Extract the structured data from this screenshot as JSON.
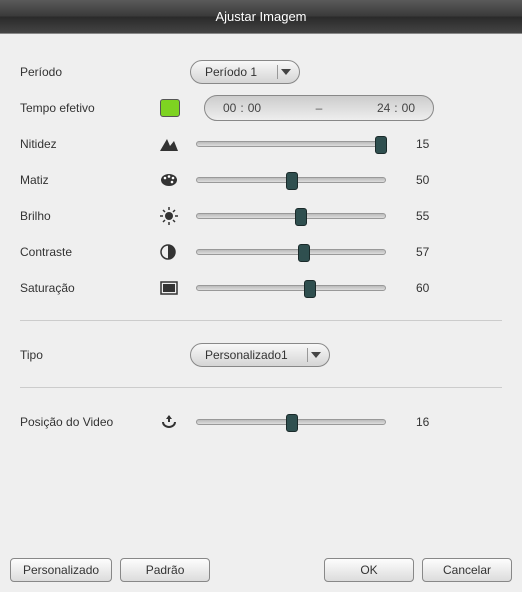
{
  "title": "Ajustar Imagem",
  "labels": {
    "periodo": "Período",
    "tempo": "Tempo efetivo",
    "nitidez": "Nitidez",
    "matiz": "Matiz",
    "brilho": "Brilho",
    "contraste": "Contraste",
    "saturacao": "Saturação",
    "tipo": "Tipo",
    "posicao": "Posição do Video"
  },
  "periodo_select": "Período 1",
  "tempo": {
    "from_h": "00",
    "from_m": "00",
    "to_h": "24",
    "to_m": "00",
    "sep": "–",
    "colon": ":"
  },
  "sliders": {
    "nitidez": {
      "value": 15,
      "min": 0,
      "max": 15
    },
    "matiz": {
      "value": 50,
      "min": 0,
      "max": 100
    },
    "brilho": {
      "value": 55,
      "min": 0,
      "max": 100
    },
    "contraste": {
      "value": 57,
      "min": 0,
      "max": 100
    },
    "saturacao": {
      "value": 60,
      "min": 0,
      "max": 100
    },
    "posicao": {
      "value": 16,
      "min": 0,
      "max": 32
    }
  },
  "tipo_select": "Personalizado1",
  "buttons": {
    "personalizado": "Personalizado",
    "padrao": "Padrão",
    "ok": "OK",
    "cancelar": "Cancelar"
  },
  "colors": {
    "chip": "#7ed321",
    "thumb": "#2f4f4f"
  }
}
